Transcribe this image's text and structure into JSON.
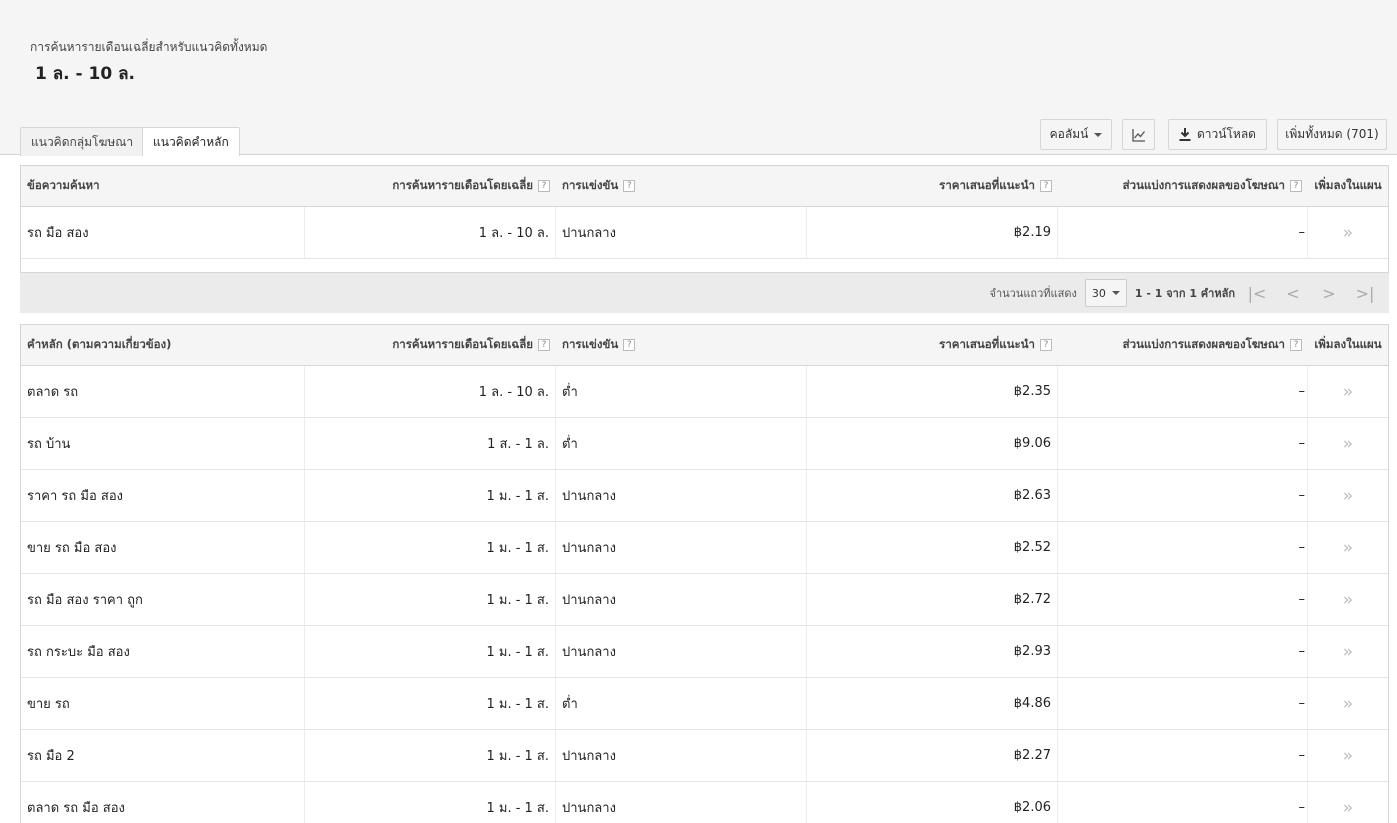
{
  "summary": {
    "label": "การค้นหารายเดือนเฉลี่ยสำหรับแนวคิดทั้งหมด",
    "value": "1 ล. - 10 ล."
  },
  "tabs": [
    {
      "label": "แนวคิดกลุ่มโฆษณา",
      "active": false
    },
    {
      "label": "แนวคิดคำหลัก",
      "active": true
    }
  ],
  "toolbar": {
    "columns_label": "คอลัมน์",
    "download_label": "ดาวน์โหลด",
    "add_all_label": "เพิ่มทั้งหมด (701)"
  },
  "search_table": {
    "headers": {
      "keyword": "ข้อความค้นหา",
      "avg_searches": "การค้นหารายเดือนโดยเฉลี่ย",
      "competition": "การแข่งขัน",
      "suggested_bid": "ราคาเสนอที่แนะนำ",
      "impression_share": "ส่วนแบ่งการแสดงผลของโฆษณา",
      "add": "เพิ่มลงในแผน"
    },
    "rows": [
      {
        "keyword": "รถ มือ สอง",
        "searches": "1 ล. - 10 ล.",
        "competition": "ปานกลาง",
        "bid": "฿2.19",
        "share": "–",
        "add": "»"
      }
    ]
  },
  "pager": {
    "rows_label": "จำนวนแถวที่แสดง",
    "rows_value": "30",
    "range_text": "1 - 1 จาก 1 คำหลัก",
    "help_icon": "question-icon"
  },
  "keyword_table": {
    "headers": {
      "keyword": "คำหลัก (ตามความเกี่ยวข้อง)",
      "avg_searches": "การค้นหารายเดือนโดยเฉลี่ย",
      "competition": "การแข่งขัน",
      "suggested_bid": "ราคาเสนอที่แนะนำ",
      "impression_share": "ส่วนแบ่งการแสดงผลของโฆษณา",
      "add": "เพิ่มลงในแผน"
    },
    "rows": [
      {
        "keyword": "ตลาด รถ",
        "searches": "1 ล. - 10 ล.",
        "competition": "ต่ำ",
        "bid": "฿2.35",
        "share": "–",
        "add": "»"
      },
      {
        "keyword": "รถ บ้าน",
        "searches": "1 ส. - 1 ล.",
        "competition": "ต่ำ",
        "bid": "฿9.06",
        "share": "–",
        "add": "»"
      },
      {
        "keyword": "ราคา รถ มือ สอง",
        "searches": "1 ม. - 1 ส.",
        "competition": "ปานกลาง",
        "bid": "฿2.63",
        "share": "–",
        "add": "»"
      },
      {
        "keyword": "ขาย รถ มือ สอง",
        "searches": "1 ม. - 1 ส.",
        "competition": "ปานกลาง",
        "bid": "฿2.52",
        "share": "–",
        "add": "»"
      },
      {
        "keyword": "รถ มือ สอง ราคา ถูก",
        "searches": "1 ม. - 1 ส.",
        "competition": "ปานกลาง",
        "bid": "฿2.72",
        "share": "–",
        "add": "»"
      },
      {
        "keyword": "รถ กระบะ มือ สอง",
        "searches": "1 ม. - 1 ส.",
        "competition": "ปานกลาง",
        "bid": "฿2.93",
        "share": "–",
        "add": "»"
      },
      {
        "keyword": "ขาย รถ",
        "searches": "1 ม. - 1 ส.",
        "competition": "ต่ำ",
        "bid": "฿4.86",
        "share": "–",
        "add": "»"
      },
      {
        "keyword": "รถ มือ 2",
        "searches": "1 ม. - 1 ส.",
        "competition": "ปานกลาง",
        "bid": "฿2.27",
        "share": "–",
        "add": "»"
      },
      {
        "keyword": "ตลาด รถ มือ สอง",
        "searches": "1 ม. - 1 ส.",
        "competition": "ปานกลาง",
        "bid": "฿2.06",
        "share": "–",
        "add": "»"
      }
    ]
  }
}
